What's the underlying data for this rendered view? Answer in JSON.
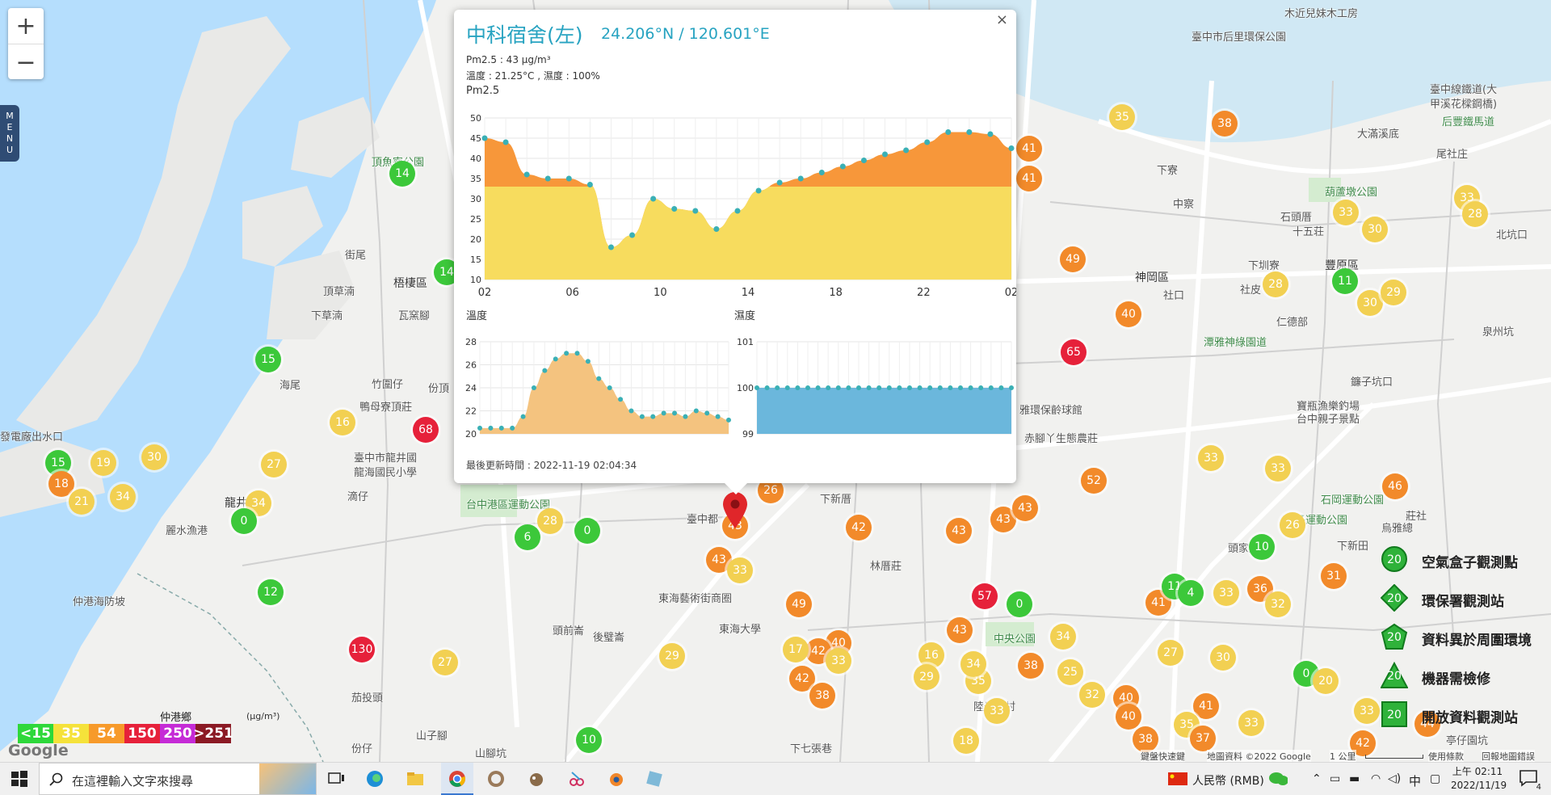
{
  "map": {
    "zoom_in": "+",
    "zoom_out": "−",
    "menu_letters": [
      "M",
      "E",
      "N",
      "U"
    ],
    "place_labels": [
      {
        "text": "臺中市后里環保公園",
        "x": 1475,
        "y": 35,
        "cls": ""
      },
      {
        "text": "木近兒妹木工房",
        "x": 1590,
        "y": 6,
        "cls": ""
      },
      {
        "text": "臺中線鐵道(大",
        "x": 1770,
        "y": 100,
        "cls": ""
      },
      {
        "text": "甲溪花樑鋼橋)",
        "x": 1770,
        "y": 118,
        "cls": ""
      },
      {
        "text": "后豐鐵馬道",
        "x": 1785,
        "y": 140,
        "cls": "grn"
      },
      {
        "text": "大滿溪底",
        "x": 1680,
        "y": 155,
        "cls": ""
      },
      {
        "text": "尾社庄",
        "x": 1778,
        "y": 180,
        "cls": ""
      },
      {
        "text": "下寮",
        "x": 1432,
        "y": 200,
        "cls": ""
      },
      {
        "text": "中察",
        "x": 1452,
        "y": 242,
        "cls": ""
      },
      {
        "text": "葫蘆墩公園",
        "x": 1640,
        "y": 227,
        "cls": "grn"
      },
      {
        "text": "石頭厝",
        "x": 1585,
        "y": 258,
        "cls": ""
      },
      {
        "text": "十五荘",
        "x": 1600,
        "y": 276,
        "cls": ""
      },
      {
        "text": "下圳寮",
        "x": 1545,
        "y": 318,
        "cls": ""
      },
      {
        "text": "神岡區",
        "x": 1405,
        "y": 333,
        "cls": "dark"
      },
      {
        "text": "豐原區",
        "x": 1640,
        "y": 318,
        "cls": "dark"
      },
      {
        "text": "社口",
        "x": 1440,
        "y": 355,
        "cls": ""
      },
      {
        "text": "社皮",
        "x": 1535,
        "y": 348,
        "cls": ""
      },
      {
        "text": "仁德部",
        "x": 1580,
        "y": 388,
        "cls": ""
      },
      {
        "text": "北坑口",
        "x": 1852,
        "y": 280,
        "cls": ""
      },
      {
        "text": "泉州坑",
        "x": 1835,
        "y": 400,
        "cls": ""
      },
      {
        "text": "鐮子坑口",
        "x": 1672,
        "y": 462,
        "cls": ""
      },
      {
        "text": "頂魚寮公園",
        "x": 460,
        "y": 190,
        "cls": "grn"
      },
      {
        "text": "街尾",
        "x": 427,
        "y": 305,
        "cls": ""
      },
      {
        "text": "頂草湳",
        "x": 400,
        "y": 350,
        "cls": ""
      },
      {
        "text": "梧棲區",
        "x": 487,
        "y": 340,
        "cls": "dark"
      },
      {
        "text": "下草湳",
        "x": 385,
        "y": 380,
        "cls": ""
      },
      {
        "text": "瓦窯腳",
        "x": 493,
        "y": 380,
        "cls": ""
      },
      {
        "text": "海尾",
        "x": 346,
        "y": 466,
        "cls": ""
      },
      {
        "text": "竹圍仔",
        "x": 460,
        "y": 465,
        "cls": ""
      },
      {
        "text": "份頂",
        "x": 530,
        "y": 470,
        "cls": ""
      },
      {
        "text": "鴨母寮頂莊",
        "x": 445,
        "y": 493,
        "cls": ""
      },
      {
        "text": "發電廠出水口",
        "x": 0,
        "y": 530,
        "cls": ""
      },
      {
        "text": "臺中市龍井國",
        "x": 438,
        "y": 556,
        "cls": ""
      },
      {
        "text": "龍海國民小學",
        "x": 438,
        "y": 574,
        "cls": ""
      },
      {
        "text": "龍井",
        "x": 278,
        "y": 612,
        "cls": "dark"
      },
      {
        "text": "滴仔",
        "x": 430,
        "y": 604,
        "cls": ""
      },
      {
        "text": "麗水漁港",
        "x": 205,
        "y": 646,
        "cls": ""
      },
      {
        "text": "台中港區運動公園",
        "x": 577,
        "y": 614,
        "cls": "grn"
      },
      {
        "text": "臺中都",
        "x": 850,
        "y": 632,
        "cls": ""
      },
      {
        "text": "下新厝",
        "x": 1015,
        "y": 607,
        "cls": ""
      },
      {
        "text": "林厝莊",
        "x": 1077,
        "y": 690,
        "cls": ""
      },
      {
        "text": "仲港海防坡",
        "x": 90,
        "y": 734,
        "cls": ""
      },
      {
        "text": "東海藝術街商圈",
        "x": 815,
        "y": 730,
        "cls": ""
      },
      {
        "text": "頭前崙",
        "x": 684,
        "y": 770,
        "cls": ""
      },
      {
        "text": "後璧崙",
        "x": 734,
        "y": 778,
        "cls": ""
      },
      {
        "text": "東海大學",
        "x": 890,
        "y": 768,
        "cls": ""
      },
      {
        "text": "中央公園",
        "x": 1230,
        "y": 780,
        "cls": "grn"
      },
      {
        "text": "陸光七村",
        "x": 1205,
        "y": 864,
        "cls": ""
      },
      {
        "text": "茄投頭",
        "x": 435,
        "y": 853,
        "cls": ""
      },
      {
        "text": "仲港鄉",
        "x": 198,
        "y": 877,
        "cls": ""
      },
      {
        "text": "份仔",
        "x": 435,
        "y": 916,
        "cls": ""
      },
      {
        "text": "山子腳",
        "x": 515,
        "y": 900,
        "cls": ""
      },
      {
        "text": "山腳坑",
        "x": 588,
        "y": 922,
        "cls": ""
      },
      {
        "text": "下七張巷",
        "x": 978,
        "y": 916,
        "cls": ""
      },
      {
        "text": "雅環保齡球館",
        "x": 1262,
        "y": 497,
        "cls": ""
      },
      {
        "text": "赤腳丫生態農莊",
        "x": 1268,
        "y": 532,
        "cls": ""
      },
      {
        "text": "潭雅神綠園道",
        "x": 1490,
        "y": 413,
        "cls": "grn"
      },
      {
        "text": "寶瓶漁樂釣場",
        "x": 1605,
        "y": 492,
        "cls": ""
      },
      {
        "text": "台中親子景點",
        "x": 1605,
        "y": 508,
        "cls": ""
      },
      {
        "text": "潭子運動公園",
        "x": 1590,
        "y": 633,
        "cls": "grn"
      },
      {
        "text": "石岡運動公園",
        "x": 1635,
        "y": 608,
        "cls": "grn"
      },
      {
        "text": "頭家厝",
        "x": 1520,
        "y": 668,
        "cls": ""
      },
      {
        "text": "下新田",
        "x": 1655,
        "y": 665,
        "cls": ""
      },
      {
        "text": "莊社",
        "x": 1740,
        "y": 628,
        "cls": ""
      },
      {
        "text": "烏雅總",
        "x": 1710,
        "y": 643,
        "cls": ""
      },
      {
        "text": "亭仔園坑",
        "x": 1790,
        "y": 906,
        "cls": ""
      }
    ],
    "markers": [
      {
        "v": "14",
        "c": "g",
        "x": 498,
        "y": 215
      },
      {
        "v": "14",
        "c": "g",
        "x": 553,
        "y": 337
      },
      {
        "v": "15",
        "c": "g",
        "x": 332,
        "y": 445
      },
      {
        "v": "16",
        "c": "y",
        "x": 424,
        "y": 523
      },
      {
        "v": "68",
        "c": "r",
        "x": 527,
        "y": 532
      },
      {
        "v": "15",
        "c": "g",
        "x": 72,
        "y": 573
      },
      {
        "v": "19",
        "c": "y",
        "x": 128,
        "y": 573
      },
      {
        "v": "30",
        "c": "y",
        "x": 191,
        "y": 566
      },
      {
        "v": "27",
        "c": "y",
        "x": 339,
        "y": 575
      },
      {
        "v": "18",
        "c": "o",
        "x": 76,
        "y": 599
      },
      {
        "v": "21",
        "c": "y",
        "x": 101,
        "y": 621
      },
      {
        "v": "34",
        "c": "y",
        "x": 152,
        "y": 615
      },
      {
        "v": "34",
        "c": "y",
        "x": 320,
        "y": 623
      },
      {
        "v": "0",
        "c": "g",
        "x": 302,
        "y": 645
      },
      {
        "v": "28",
        "c": "y",
        "x": 681,
        "y": 645
      },
      {
        "v": "6",
        "c": "g",
        "x": 653,
        "y": 665
      },
      {
        "v": "0",
        "c": "g",
        "x": 727,
        "y": 657
      },
      {
        "v": "12",
        "c": "g",
        "x": 335,
        "y": 733
      },
      {
        "v": "130",
        "c": "r",
        "x": 448,
        "y": 804
      },
      {
        "v": "27",
        "c": "y",
        "x": 551,
        "y": 820
      },
      {
        "v": "10",
        "c": "g",
        "x": 729,
        "y": 916
      },
      {
        "v": "29",
        "c": "y",
        "x": 832,
        "y": 812
      },
      {
        "v": "26",
        "c": "o",
        "x": 954,
        "y": 607
      },
      {
        "v": "43",
        "c": "o",
        "x": 910,
        "y": 651
      },
      {
        "v": "43",
        "c": "o",
        "x": 890,
        "y": 693
      },
      {
        "v": "33",
        "c": "y",
        "x": 916,
        "y": 706
      },
      {
        "v": "42",
        "c": "o",
        "x": 1063,
        "y": 653
      },
      {
        "v": "49",
        "c": "o",
        "x": 989,
        "y": 748
      },
      {
        "v": "40",
        "c": "o",
        "x": 1038,
        "y": 796
      },
      {
        "v": "42",
        "c": "o",
        "x": 1013,
        "y": 806
      },
      {
        "v": "17",
        "c": "y",
        "x": 985,
        "y": 804
      },
      {
        "v": "33",
        "c": "y",
        "x": 1038,
        "y": 818
      },
      {
        "v": "42",
        "c": "o",
        "x": 993,
        "y": 840
      },
      {
        "v": "38",
        "c": "o",
        "x": 1018,
        "y": 861
      },
      {
        "v": "16",
        "c": "y",
        "x": 1153,
        "y": 811
      },
      {
        "v": "29",
        "c": "y",
        "x": 1147,
        "y": 838
      },
      {
        "v": "43",
        "c": "o",
        "x": 1187,
        "y": 657
      },
      {
        "v": "57",
        "c": "r",
        "x": 1219,
        "y": 738
      },
      {
        "v": "0",
        "c": "g",
        "x": 1262,
        "y": 748
      },
      {
        "v": "43",
        "c": "o",
        "x": 1188,
        "y": 780
      },
      {
        "v": "43",
        "c": "o",
        "x": 1242,
        "y": 643
      },
      {
        "v": "43",
        "c": "o",
        "x": 1269,
        "y": 629
      },
      {
        "v": "35",
        "c": "y",
        "x": 1211,
        "y": 843
      },
      {
        "v": "34",
        "c": "y",
        "x": 1205,
        "y": 822
      },
      {
        "v": "33",
        "c": "y",
        "x": 1234,
        "y": 880
      },
      {
        "v": "18",
        "c": "y",
        "x": 1196,
        "y": 917
      },
      {
        "v": "38",
        "c": "o",
        "x": 1276,
        "y": 824
      },
      {
        "v": "34",
        "c": "y",
        "x": 1316,
        "y": 788
      },
      {
        "v": "25",
        "c": "y",
        "x": 1325,
        "y": 832
      },
      {
        "v": "32",
        "c": "y",
        "x": 1352,
        "y": 860
      },
      {
        "v": "40",
        "c": "o",
        "x": 1394,
        "y": 864
      },
      {
        "v": "40",
        "c": "o",
        "x": 1397,
        "y": 887
      },
      {
        "v": "38",
        "c": "o",
        "x": 1418,
        "y": 915
      },
      {
        "v": "52",
        "c": "o",
        "x": 1354,
        "y": 595
      },
      {
        "v": "33",
        "c": "y",
        "x": 1499,
        "y": 567
      },
      {
        "v": "33",
        "c": "y",
        "x": 1582,
        "y": 580
      },
      {
        "v": "26",
        "c": "y",
        "x": 1600,
        "y": 650
      },
      {
        "v": "10",
        "c": "g",
        "x": 1562,
        "y": 677
      },
      {
        "v": "46",
        "c": "o",
        "x": 1727,
        "y": 602
      },
      {
        "v": "33",
        "c": "y",
        "x": 1518,
        "y": 734
      },
      {
        "v": "36",
        "c": "o",
        "x": 1560,
        "y": 729
      },
      {
        "v": "32",
        "c": "y",
        "x": 1582,
        "y": 748
      },
      {
        "v": "31",
        "c": "o",
        "x": 1651,
        "y": 713
      },
      {
        "v": "41",
        "c": "o",
        "x": 1434,
        "y": 746
      },
      {
        "v": "11",
        "c": "g",
        "x": 1454,
        "y": 726
      },
      {
        "v": "4",
        "c": "g",
        "x": 1474,
        "y": 734
      },
      {
        "v": "27",
        "c": "y",
        "x": 1449,
        "y": 808
      },
      {
        "v": "30",
        "c": "y",
        "x": 1514,
        "y": 814
      },
      {
        "v": "0",
        "c": "g",
        "x": 1617,
        "y": 834
      },
      {
        "v": "20",
        "c": "y",
        "x": 1641,
        "y": 843
      },
      {
        "v": "41",
        "c": "o",
        "x": 1493,
        "y": 874
      },
      {
        "v": "35",
        "c": "y",
        "x": 1469,
        "y": 897
      },
      {
        "v": "37",
        "c": "o",
        "x": 1489,
        "y": 914
      },
      {
        "v": "33",
        "c": "y",
        "x": 1549,
        "y": 895
      },
      {
        "v": "33",
        "c": "y",
        "x": 1692,
        "y": 880
      },
      {
        "v": "44",
        "c": "o",
        "x": 1767,
        "y": 896
      },
      {
        "v": "42",
        "c": "o",
        "x": 1687,
        "y": 920
      },
      {
        "v": "35",
        "c": "y",
        "x": 1389,
        "y": 145
      },
      {
        "v": "38",
        "c": "o",
        "x": 1516,
        "y": 153
      },
      {
        "v": "41",
        "c": "o",
        "x": 1274,
        "y": 184
      },
      {
        "v": "41",
        "c": "o",
        "x": 1274,
        "y": 221
      },
      {
        "v": "49",
        "c": "o",
        "x": 1328,
        "y": 321
      },
      {
        "v": "40",
        "c": "o",
        "x": 1397,
        "y": 389
      },
      {
        "v": "65",
        "c": "r",
        "x": 1329,
        "y": 436
      },
      {
        "v": "33",
        "c": "y",
        "x": 1666,
        "y": 263
      },
      {
        "v": "30",
        "c": "y",
        "x": 1702,
        "y": 284
      },
      {
        "v": "28",
        "c": "y",
        "x": 1579,
        "y": 352
      },
      {
        "v": "11",
        "c": "g",
        "x": 1665,
        "y": 348
      },
      {
        "v": "30",
        "c": "y",
        "x": 1696,
        "y": 375
      },
      {
        "v": "29",
        "c": "y",
        "x": 1725,
        "y": 362
      },
      {
        "v": "33",
        "c": "y",
        "x": 1816,
        "y": 245
      },
      {
        "v": "28",
        "c": "y",
        "x": 1826,
        "y": 265
      }
    ]
  },
  "popup": {
    "close": "×",
    "title": "中科宿舍(左)",
    "coords": "24.206°N / 120.601°E",
    "pm_line": "Pm2.5 : 43 μg/m³",
    "temp_line": "溫度 : 21.25°C , 濕度 : 100%",
    "pm_heading": "Pm2.5",
    "temp_heading": "溫度",
    "hum_heading": "濕度",
    "updated": "最後更新時間 : 2022-11-19 02:04:34"
  },
  "chart_data": [
    {
      "type": "area",
      "title": "Pm2.5",
      "x": [
        "02",
        "",
        "",
        "",
        "06",
        "",
        "",
        "",
        "10",
        "",
        "",
        "",
        "14",
        "",
        "",
        "",
        "18",
        "",
        "",
        "",
        "22",
        "",
        "",
        "",
        "02"
      ],
      "xtick_labels": [
        "02",
        "06",
        "10",
        "14",
        "18",
        "22",
        "02"
      ],
      "values": [
        45,
        44,
        36,
        35,
        35,
        33.5,
        18,
        21,
        30,
        27.5,
        27,
        22.5,
        27,
        32,
        34,
        35,
        36.5,
        38,
        39.5,
        41,
        42,
        44,
        46.5,
        46.5,
        46,
        42.5
      ],
      "ylim": [
        10,
        50
      ],
      "yticks": [
        10,
        15,
        20,
        25,
        30,
        35,
        40,
        45,
        50
      ],
      "colors": {
        "low": "#f7dc5e",
        "high": "#f7973a",
        "dot": "#3ab0b5"
      }
    },
    {
      "type": "area",
      "title": "溫度",
      "values": [
        20.5,
        20.5,
        20.5,
        20.5,
        21.5,
        24,
        25.5,
        26.5,
        27,
        27,
        26.3,
        24.8,
        24,
        23,
        22,
        21.5,
        21.5,
        21.8,
        21.8,
        21.5,
        22,
        21.8,
        21.5,
        21.2
      ],
      "ylim": [
        20,
        28
      ],
      "yticks": [
        20,
        22,
        24,
        26,
        28
      ],
      "colors": {
        "fill": "#f4c37f",
        "dot": "#3ab0b5"
      }
    },
    {
      "type": "area",
      "title": "濕度",
      "values": [
        100,
        100,
        100,
        100,
        100,
        100,
        100,
        100,
        100,
        100,
        100,
        100,
        100,
        100,
        100,
        100,
        100,
        100,
        100,
        100,
        100,
        100,
        100,
        100,
        100,
        100
      ],
      "ylim": [
        99,
        101
      ],
      "yticks": [
        99,
        100,
        101
      ],
      "colors": {
        "fill": "#6bb7dc",
        "dot": "#3ab0b5"
      }
    }
  ],
  "aqi_legend": {
    "header": "仲港鄉",
    "unit": "(μg/m³)",
    "items": [
      {
        "label": "<15",
        "color": "#2ed83a"
      },
      {
        "label": "35",
        "color": "#f5e23a"
      },
      {
        "label": "54",
        "color": "#f79a2a"
      },
      {
        "label": "150",
        "color": "#e6213a"
      },
      {
        "label": "250",
        "color": "#c52bd6"
      },
      {
        "label": ">251",
        "color": "#8b1a24"
      }
    ]
  },
  "station_legend": {
    "items": [
      {
        "value": "20",
        "label": "空氣盒子觀測點",
        "shape": "circle"
      },
      {
        "value": "20",
        "label": "環保署觀測站",
        "shape": "diamond"
      },
      {
        "value": "20",
        "label": "資料異於周圍環境",
        "shape": "pentagon"
      },
      {
        "value": "20",
        "label": "機器需檢修",
        "shape": "triangle"
      },
      {
        "value": "20",
        "label": "開放資料觀測站",
        "shape": "square"
      }
    ]
  },
  "attribution": {
    "google": "Google",
    "shortcuts": "鍵盤快速鍵",
    "mapdata": "地圖資料 ©2022 Google",
    "scale": "1 公里",
    "terms": "使用條款",
    "report": "回報地圖錯誤"
  },
  "taskbar": {
    "search_placeholder": "在這裡輸入文字來搜尋",
    "currency": "人民幣 (RMB)",
    "ime": "中",
    "time": "上午 02:11",
    "date": "2022/11/19",
    "notif_count": "4"
  }
}
